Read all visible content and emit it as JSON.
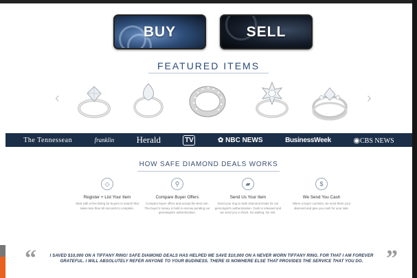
{
  "cta": {
    "buy_label": "BUY",
    "sell_label": "SELL"
  },
  "featured": {
    "title": "FEATURED ITEMS",
    "prev_arrow": "‹",
    "next_arrow": "›",
    "items": [
      "ring-1",
      "ring-2",
      "ring-3",
      "ring-4",
      "ring-5"
    ]
  },
  "press": {
    "logos": [
      "The Tennessean",
      "franklin",
      "Herald",
      "TV",
      "NBC NEWS",
      "BusinessWeek",
      "CBS NEWS"
    ]
  },
  "how": {
    "title": "HOW SAFE DIAMOND DEALS WORKS",
    "steps": [
      {
        "icon": "diamond-icon",
        "glyph": "◇",
        "title": "Register + List Your Item",
        "desc": "Start with a free listing for buyers to search that takes less than 60 seconds to complete."
      },
      {
        "icon": "compare-icon",
        "glyph": "⚲",
        "title": "Compare Buyer Offers",
        "desc": "Compare buyer offers and accept the best one. The buyer's money is held in escrow pending our gemologist's authentication."
      },
      {
        "icon": "send-icon",
        "glyph": "▰",
        "title": "Send Us Your Item",
        "desc": "Send your ring to Safe Diamond Deals for our gemologist's authentication. Cash is released and we send you a check. No waiting. No risk."
      },
      {
        "icon": "dollar-icon",
        "glyph": "$",
        "title": "We Send You Cash",
        "desc": "When a buyer commits, we send them your diamond and give you cash for your sale."
      }
    ]
  },
  "testimonial": {
    "open_mark": "“",
    "close_mark": "”",
    "text": "I SAVED $10,000 ON A TIFFANY RING! SAFE DIAMOND DEALS HAS HELPED ME SAVE $10,000 ON A NEVER WORN TIFFANY RING. FOR THAT I AM FOREVER GRATEFUL. I WILL ABSOLUTELY REFER ANYONE TO YOUR BUDINESS. THERE IS NOWHERE ELSE THAT PROVIDES THE SERVICE THAT YOU DO."
  },
  "colors": {
    "navy": "#1c2f48",
    "accent": "#2a4a78",
    "orange": "#e8611e"
  }
}
